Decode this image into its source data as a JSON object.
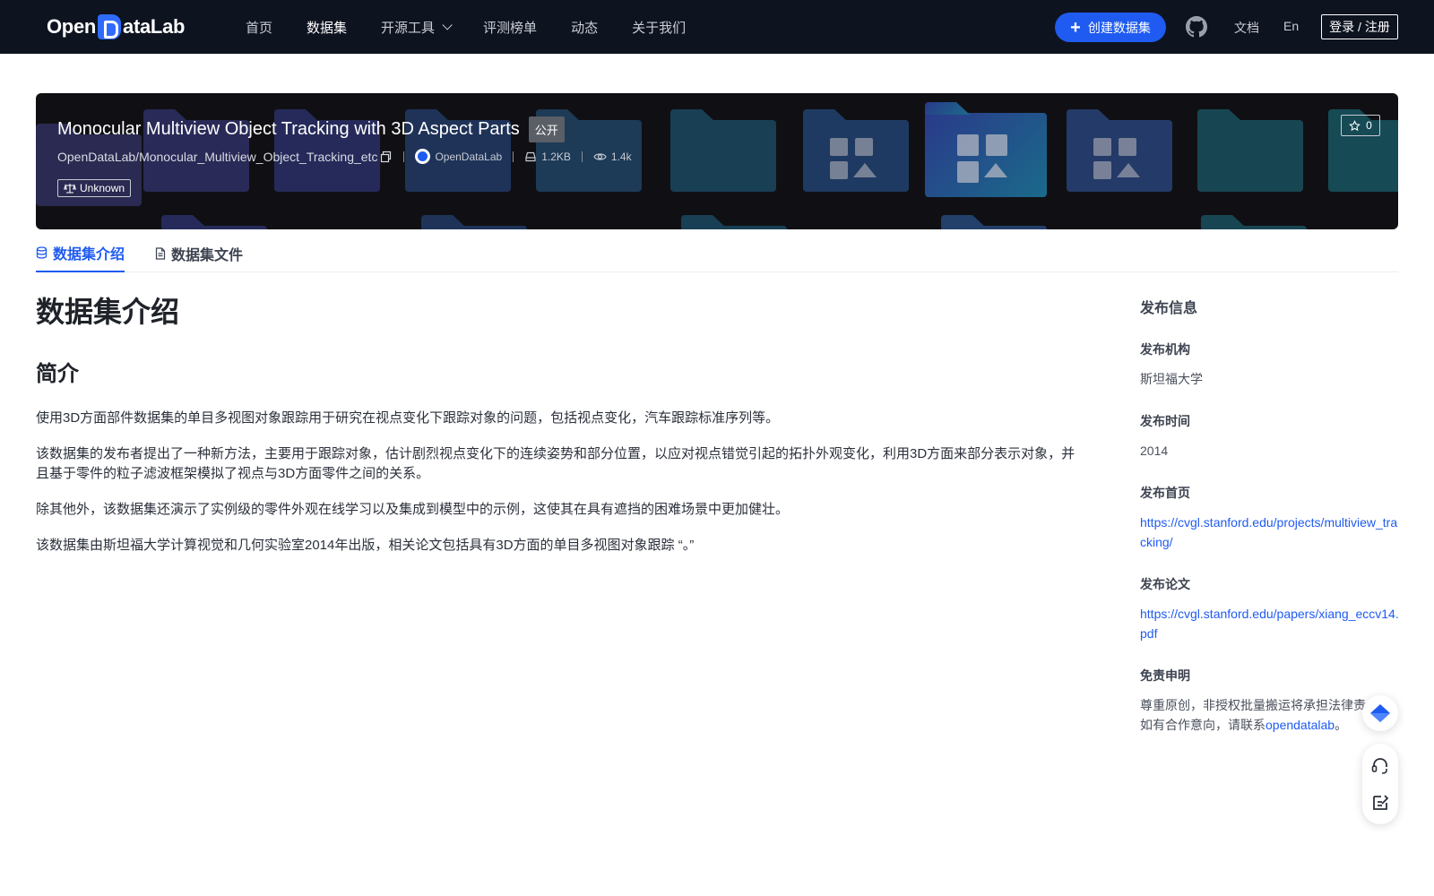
{
  "nav": {
    "logo_text": "OpenDataLab",
    "items": [
      {
        "label": "首页"
      },
      {
        "label": "数据集",
        "active": true
      },
      {
        "label": "开源工具"
      },
      {
        "label": "评测榜单"
      },
      {
        "label": "动态"
      },
      {
        "label": "关于我们"
      }
    ],
    "create_button": "创建数据集",
    "docs": "文档",
    "lang": "En",
    "login": "登录 / 注册"
  },
  "banner": {
    "title": "Monocular Multiview Object Tracking with 3D Aspect Parts",
    "badge": "公开",
    "repo": "OpenDataLab/Monocular_Multiview_Object_Tracking_etc",
    "org": "OpenDataLab",
    "size": "1.2KB",
    "views": "1.4k",
    "license": "Unknown",
    "stars": "0"
  },
  "tabs": [
    {
      "label": "数据集介绍",
      "active": true
    },
    {
      "label": "数据集文件"
    }
  ],
  "content": {
    "heading": "数据集介绍",
    "subheading": "简介",
    "paragraphs": [
      "使用3D方面部件数据集的单目多视图对象跟踪用于研究在视点变化下跟踪对象的问题，包括视点变化，汽车跟踪标准序列等。",
      "该数据集的发布者提出了一种新方法，主要用于跟踪对象，估计剧烈视点变化下的连续姿势和部分位置，以应对视点错觉引起的拓扑外观变化，利用3D方面来部分表示对象，并且基于零件的粒子滤波框架模拟了视点与3D方面零件之间的关系。",
      "除其他外，该数据集还演示了实例级的零件外观在线学习以及集成到模型中的示例，这使其在具有遮挡的困难场景中更加健壮。",
      "该数据集由斯坦福大学计算视觉和几何实验室2014年出版，相关论文包括具有3D方面的单目多视图对象跟踪 “。”"
    ]
  },
  "sidebar": {
    "title": "发布信息",
    "org_label": "发布机构",
    "org_value": "斯坦福大学",
    "time_label": "发布时间",
    "time_value": "2014",
    "homepage_label": "发布首页",
    "homepage_url": "https://cvgl.stanford.edu/projects/multiview_tracking/",
    "paper_label": "发布论文",
    "paper_url": "https://cvgl.stanford.edu/papers/xiang_eccv14.pdf",
    "disclaimer_label": "免责申明",
    "disclaimer_line1": "尊重原创，非授权批量搬运将承担法律责任。",
    "disclaimer_line2_prefix": "如有合作意向，请联系",
    "disclaimer_link": "opendatalab",
    "disclaimer_line2_suffix": "。"
  },
  "colors": {
    "nav_bg": "#0e1320",
    "accent": "#1f5bf0",
    "banner_bg": "#101014"
  },
  "icons": [
    "chevron-down-icon",
    "plus-icon",
    "github-icon",
    "copy-icon",
    "drive-icon",
    "eye-icon",
    "scale-icon",
    "star-icon",
    "database-icon",
    "file-icon",
    "diamond-icon",
    "headset-icon",
    "edit-icon"
  ]
}
